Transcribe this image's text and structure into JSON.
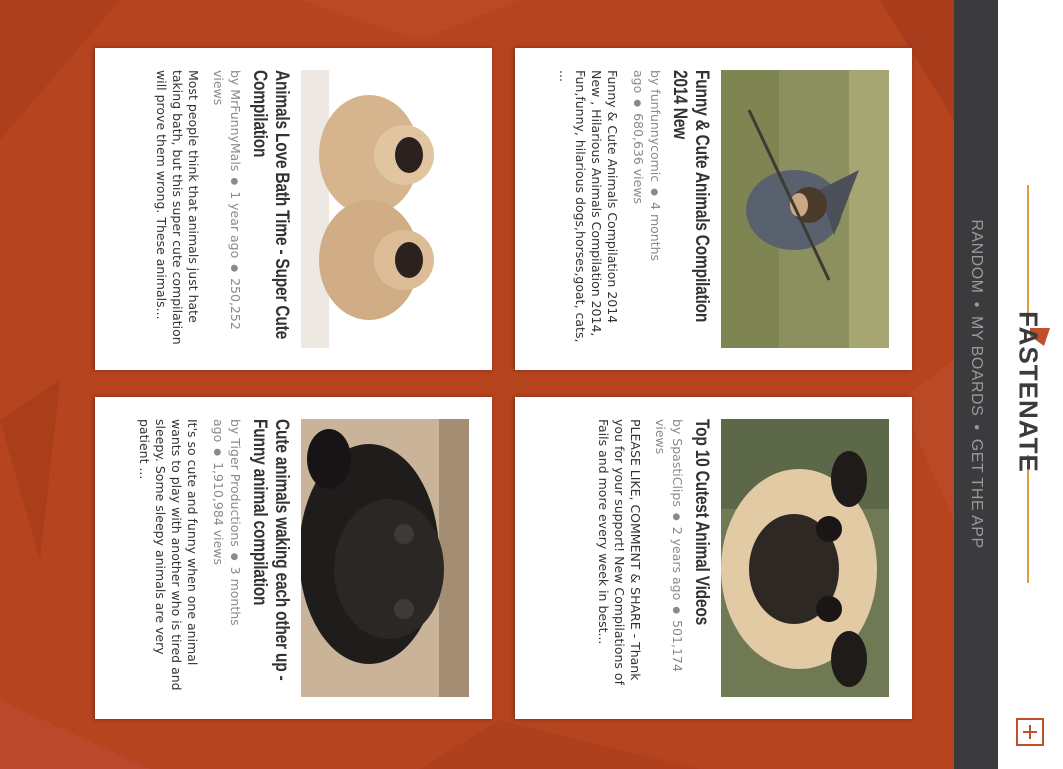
{
  "nav": {
    "items": [
      "RANDOM",
      "MY BOARDS",
      "GET THE APP"
    ]
  },
  "brand": {
    "logo": "FASTENATE",
    "accent_color": "#e59a46",
    "rail_color": "#3b3b3d",
    "background_color": "#b5441f"
  },
  "add_button": {
    "icon": "plus-icon"
  },
  "cards": [
    {
      "title": "Funny & Cute Animals Compilation 2014 New",
      "author": "by funfunnycomic",
      "age": "4 months ago",
      "views": "680,636 views",
      "description": "Funny & Cute Animals Compilation 2014 New , Hilarious Animals Compilation 2014, Fun,funny, hilarious dogs,horses,goat, cats, ...",
      "thumbnail": "pug-in-wizard-costume-thumbnail"
    },
    {
      "title": "Animals Love Bath Time - Super Cute Compilation",
      "author": "by MrFunnyMals",
      "age": "1 year ago",
      "views": "250,252 views",
      "description": "Most people think that animals just hate taking bath, but this super cute compilation will prove them wrong. These animals...",
      "thumbnail": "two-pug-puppies-thumbnail"
    },
    {
      "title": "Top 10 Cutest Animal Videos",
      "author": "by SpastiClips",
      "age": "2 years ago",
      "views": "501,174 views",
      "description": "PLEASE LIKE, COMMENT & SHARE - Thank you for your support! New Compilations of Fails and more every week in best...",
      "thumbnail": "pug-face-thumbnail"
    },
    {
      "title": "Cute animals waking each other up - Funny animal compilation",
      "author": "by Tiger Productions",
      "age": "3 months ago",
      "views": "1,910,984 views",
      "description": "It's so cute and funny when one animal wants to play with another who is tired and sleepy. Some sleepy animals are very patient ...",
      "thumbnail": "black-pug-puppy-thumbnail"
    }
  ]
}
